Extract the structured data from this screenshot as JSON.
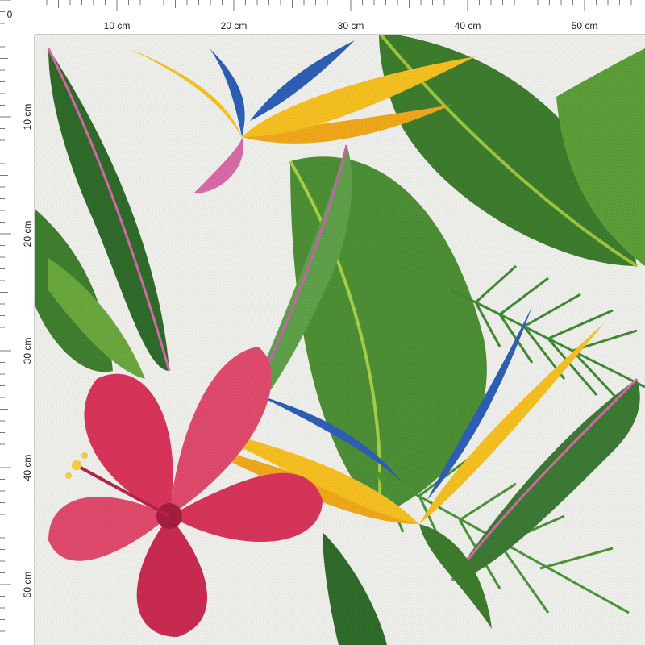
{
  "ruler": {
    "origin_label": "0",
    "top_labels": [
      "10 cm",
      "20 cm",
      "30 cm",
      "40 cm",
      "50 cm"
    ],
    "left_labels": [
      "10 cm",
      "20 cm",
      "30 cm",
      "40 cm",
      "50 cm"
    ]
  },
  "pattern": {
    "motifs": [
      "hibiscus-flower",
      "bird-of-paradise-flower",
      "banana-leaf",
      "palm-frond"
    ],
    "colors": {
      "background": "#efefec",
      "leaf_dark": "#2f6b2a",
      "leaf_mid": "#4d8f35",
      "leaf_light": "#9cc63f",
      "hibiscus": "#d8345a",
      "bird_orange": "#f0a81a",
      "bird_blue": "#2d5fb6",
      "leaf_edge_pink": "#d86aa8"
    }
  }
}
